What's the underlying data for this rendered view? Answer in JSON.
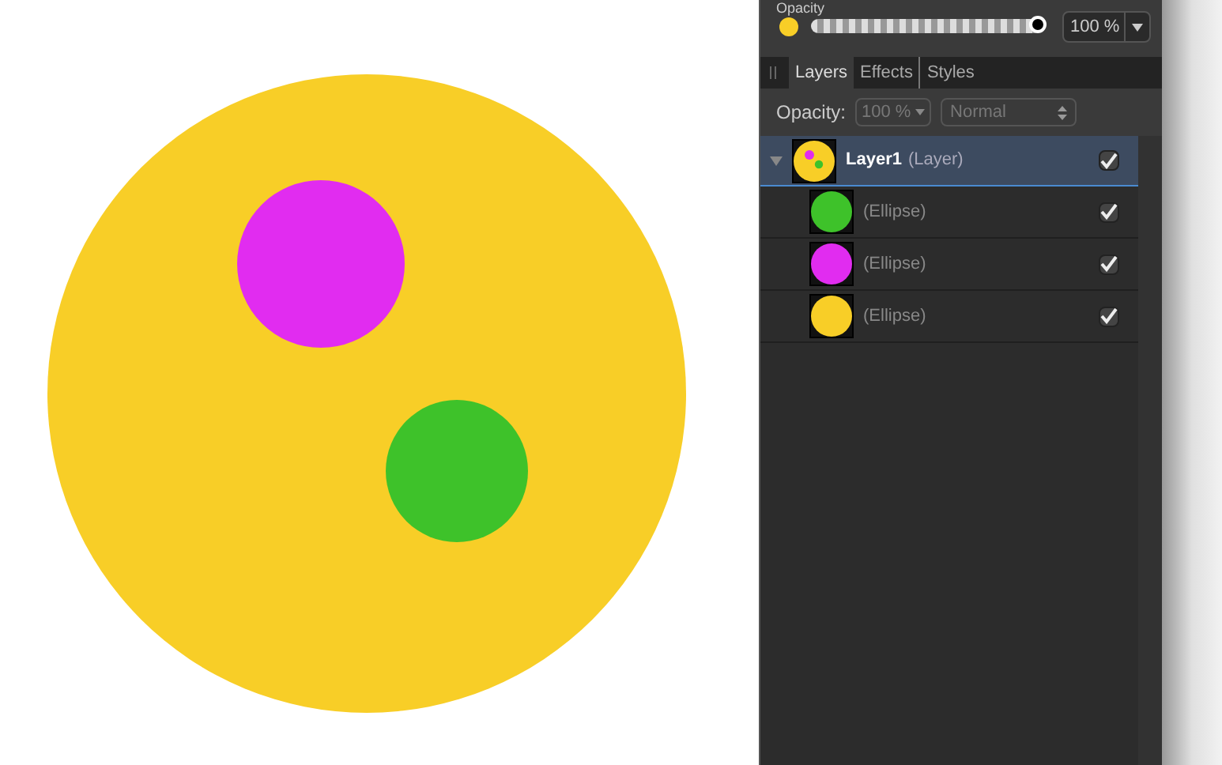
{
  "color_panel": {
    "label": "Opacity",
    "color": "#f8ce27",
    "level": 1.0,
    "value": "100 %"
  },
  "tabs": [
    {
      "label": "Layers",
      "selected": true
    },
    {
      "label": "Effects",
      "selected": false
    },
    {
      "label": "Styles",
      "selected": false
    }
  ],
  "layer_opacity": {
    "label": "Opacity:",
    "value": "100 %",
    "blend_mode": "Normal"
  },
  "layers": [
    {
      "name": "Layer1",
      "type": "(Layer)",
      "selected": true,
      "expanded": true,
      "checked": true,
      "children": [
        {
          "name": "(Ellipse)",
          "color": "#3ec22a",
          "checked": true,
          "selected": false
        },
        {
          "name": "(Ellipse)",
          "color": "#e12cf0",
          "checked": true,
          "selected": false
        },
        {
          "name": "(Ellipse)",
          "color": "#f8ce27",
          "checked": true,
          "selected": false
        }
      ]
    }
  ]
}
